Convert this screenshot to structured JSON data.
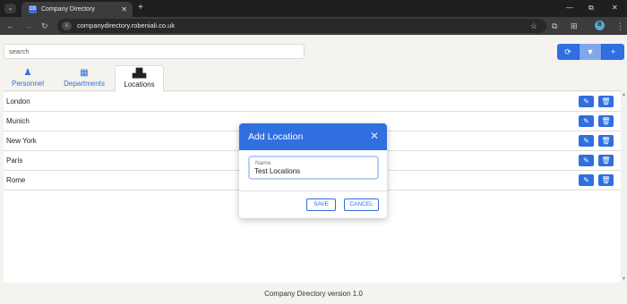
{
  "browser": {
    "tab_title": "Company Directory",
    "favicon_text": "CD",
    "url": "companydirectory.robeniali.co.uk",
    "profile_initial": "B"
  },
  "icons": {
    "menu": "chevron-down-icon",
    "close": "close-icon",
    "new_tab": "plus-icon",
    "back": "back-arrow-icon",
    "forward": "forward-arrow-icon",
    "reload": "reload-icon",
    "site_info": "tune-icon",
    "bookmark": "star-icon",
    "extension": "puzzle-icon",
    "refresh": "refresh-icon",
    "filter": "filter-icon",
    "add": "plus-icon",
    "edit": "pencil-icon",
    "delete": "trash-icon"
  },
  "search": {
    "placeholder": "search"
  },
  "nav_tabs": [
    {
      "label": "Personnel",
      "icon": "person-icon"
    },
    {
      "label": "Departments",
      "icon": "building-icon"
    },
    {
      "label": "Locations",
      "icon": "map-icon",
      "active": true
    }
  ],
  "locations": [
    {
      "name": "London"
    },
    {
      "name": "Munich"
    },
    {
      "name": "New York"
    },
    {
      "name": "Paris"
    },
    {
      "name": "Rome"
    }
  ],
  "footer": {
    "text": "Company Directory version 1.0"
  },
  "modal": {
    "title": "Add Location",
    "field_label": "Name",
    "field_value": "Test Locations",
    "save_label": "SAVE",
    "cancel_label": "CANCEL"
  },
  "colors": {
    "accent": "#2f6fe0",
    "background": "#f5f3ee",
    "chrome": "#1f1f1f"
  }
}
